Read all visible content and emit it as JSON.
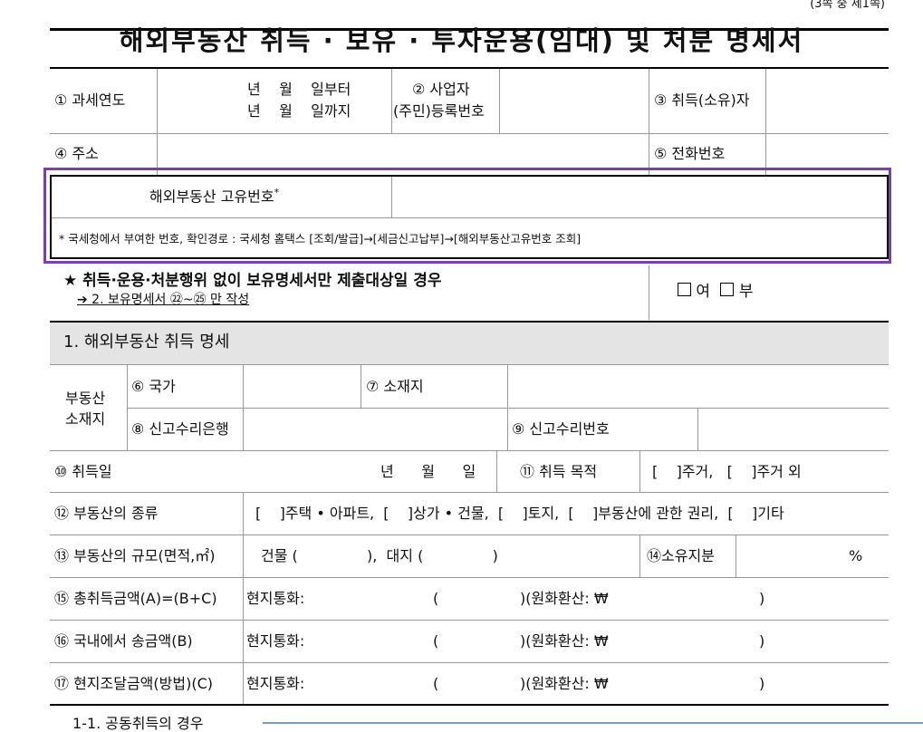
{
  "page_note": "(3쪽 중 제1쪽)",
  "title": "해외부동산 취득 · 보유 · 투자운용(임대) 및 처분 명세서",
  "header": {
    "tax_year_label": "① 과세연도",
    "from": "년    월    일부터",
    "to": "년    월    일까지",
    "reg_label_1": "② 사업자",
    "reg_label_2": "(주민)등록번호",
    "acquirer_label": "③ 취득(소유)자",
    "address_label": "④ 주소",
    "phone_label": "⑤ 전화번호"
  },
  "unique_no": {
    "label": "해외부동산 고유번호",
    "star": "*",
    "note": "* 국세청에서 부여한 번호, 확인경로 : 국세청 홈택스 [조회/발급]→[세금신고납부]→[해외부동산고유번호 조회]"
  },
  "holding_only": {
    "text": "★ 취득·운용·처분행위 없이 보유명세서만 제출대상일 경우",
    "sub": "➔ 2. 보유명세서 ㉒~㉕ 만 작성",
    "yes": "여",
    "no": "부"
  },
  "section1": {
    "title": "1. 해외부동산 취득 명세",
    "location_label": "부동산\n소재지",
    "country": "⑥ 국가",
    "address": "⑦ 소재지",
    "bank": "⑧ 신고수리은행",
    "report_no": "⑨ 신고수리번호",
    "acq_date": "⑩ 취득일",
    "acq_date_value": "년      월      일",
    "purpose": "⑪ 취득 목적",
    "purpose_opts": "[    ]주거,   [    ]주거 외",
    "type": "⑫ 부동산의 종류",
    "type_opts": "[    ]주택 • 아파트,  [    ]상가 • 건물,  [    ]토지,  [    ]부동산에 관한 권리,  [    ]기타",
    "size": "⑬ 부동산의 규모(면적,㎡)",
    "size_value": "건물 (               ),  대지 (               )",
    "share": "⑭소유지분",
    "share_unit": "%",
    "amounts": [
      {
        "label": "⑮ 총취득금액(A)=(B+C)"
      },
      {
        "label": "⑯ 국내에서 송금액(B)"
      },
      {
        "label": "⑰ 현지조달금액(방법)(C)"
      }
    ],
    "local": "현지통화:",
    "paren_open": "(",
    "krw": ")(원화환산: ₩",
    "paren_close": ")"
  },
  "next_section": "1-1. 공동취득의 경우"
}
